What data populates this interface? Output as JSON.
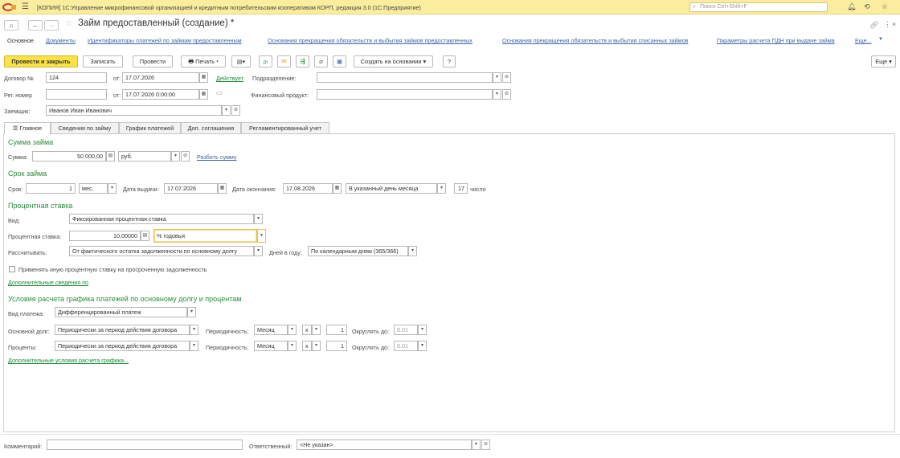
{
  "titlebar": {
    "app_title": "[КОПИЯ] 1С:Управление микрофинансовой организацией и кредитным потребительским кооперативом КОРП, редакция 3.0  (1С:Предприятие)",
    "search_placeholder": "Поиск Ctrl+Shift+F"
  },
  "header": {
    "title": "Займ предоставленный (создание) *"
  },
  "linkbar": [
    "Основное",
    "Документы",
    "Идентификаторы платежей по займам предоставленным",
    "Основания прекращения обязательств и выбытия займов предоставленных",
    "Основания прекращения обязательств и выбытия списанных займов",
    "Параметры расчета ПДН при выдаче займа",
    "Еще..."
  ],
  "toolbar": {
    "post_close": "Провести и закрыть",
    "save": "Записать",
    "post": "Провести",
    "print": "Печать",
    "create_basis": "Создать на основании",
    "help": "?",
    "more": "Еще"
  },
  "doc": {
    "number_label": "Договор №",
    "number_value": "124",
    "from_label": "от:",
    "date_value": "17.07.2026",
    "active_link": "Действует",
    "division_label": "Подразделение:",
    "division_value": "",
    "reg_label": "Рег. номер",
    "reg_value": "",
    "reg_date_value": "17.07.2026  0:00:00",
    "product_label": "Финансовый продукт:",
    "product_value": "",
    "borrower_label": "Заемщик:",
    "borrower_value": "Иванов Иван Иванович"
  },
  "tabs": [
    "Главное",
    "Сведения по займу",
    "График платежей",
    "Доп. соглашения",
    "Регламентированный учет"
  ],
  "amount": {
    "section": "Сумма займа",
    "label": "Сумма:",
    "value": "50 000,00",
    "currency": "руб.",
    "split_link": "Разбить сумму"
  },
  "term": {
    "section": "Срок займа",
    "label": "Срок:",
    "value": "1",
    "unit": "мес.",
    "issue_label": "Дата выдачи:",
    "issue_value": "17.07.2026",
    "end_label": "Дата окончания:",
    "end_value": "17.08.2026",
    "day_mode": "В указанный день месяца",
    "day_value": "17",
    "day_suffix": "число"
  },
  "rate": {
    "section": "Процентная ставка",
    "kind_label": "Вид:",
    "kind_value": "Фиксированная процентная ставка",
    "rate_label": "Процентная ставка:",
    "rate_value": "10,00000",
    "rate_unit": "% годовых",
    "calc_label": "Рассчитывать:",
    "calc_value": "От фактического остатка задолженности по основному долгу",
    "days_label": "Дней в году:",
    "days_value": "По календарным дням (365/366)",
    "overdue_check": "Применять иную процентную ставку на просроченную задолженность",
    "extra_link": "Дополнительные сведения по"
  },
  "schedule": {
    "section": "Условия расчета графика платежей по основному долгу и процентам",
    "pay_type_label": "Вид платежа:",
    "pay_type_value": "Дифференцированный платеж",
    "principal_label": "Основной долг:",
    "interest_label": "Проценты:",
    "period_value": "Периодически за период действия договора",
    "freq_label": "Периодичность:",
    "freq_value": "Месяц",
    "mult_value": "х",
    "count_value": "1",
    "round_label": "Округлять до:",
    "round_value": "0.01",
    "extra_link": "Дополнительные условия расчета графика..."
  },
  "footer": {
    "comment_label": "Комментарий:",
    "comment_value": "",
    "resp_label": "Ответственный:",
    "resp_value": "<Не указан>"
  }
}
